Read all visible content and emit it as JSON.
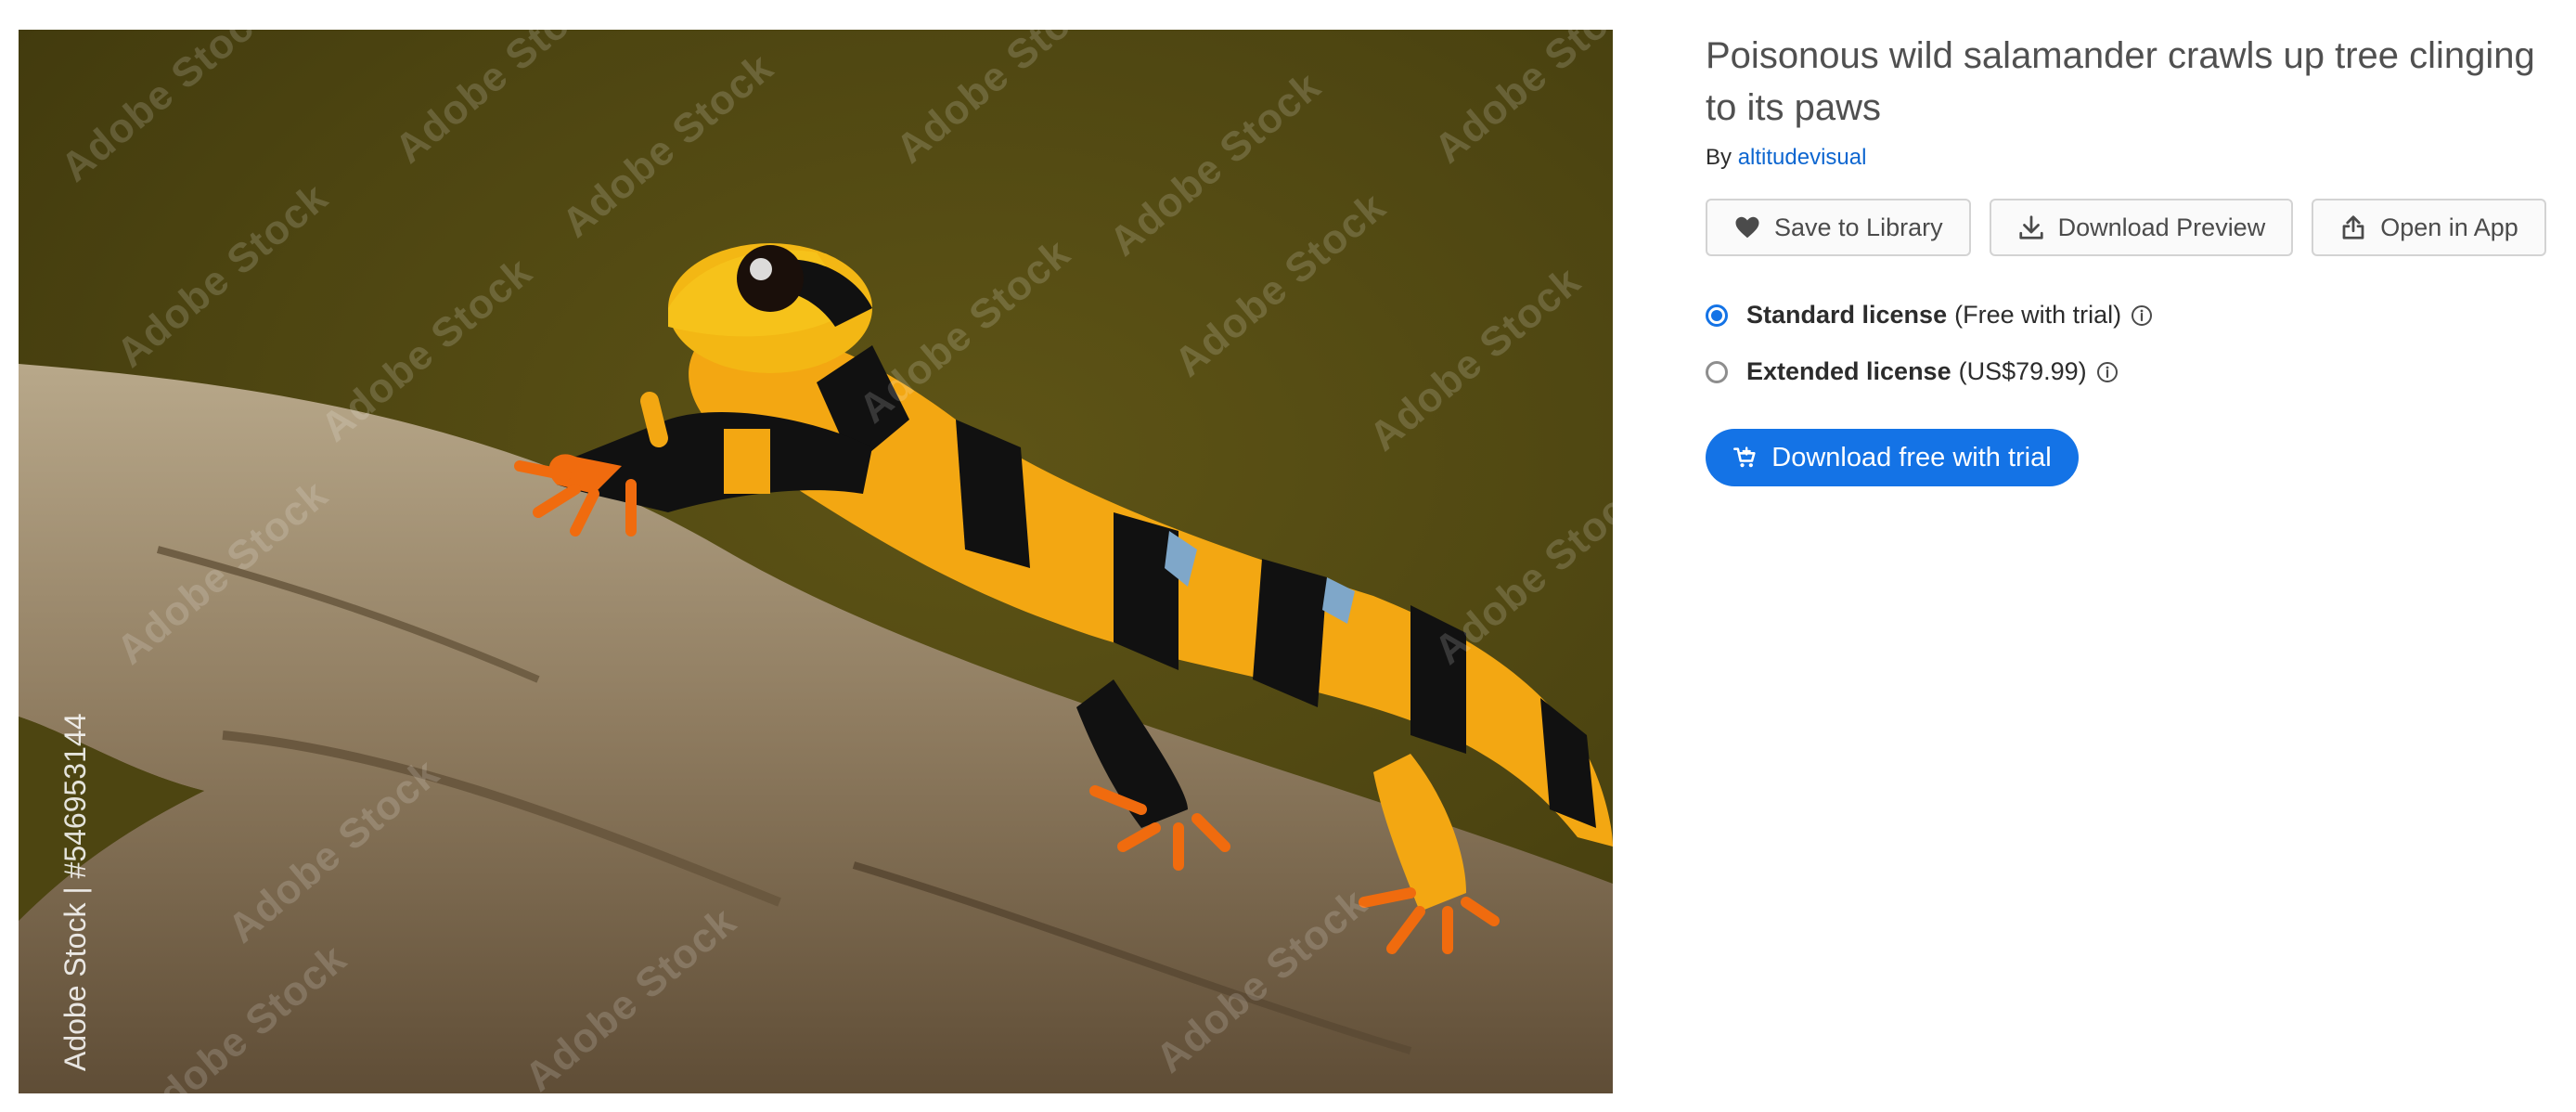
{
  "image": {
    "watermark_text": "Adobe Stock",
    "credit": "Adobe Stock | #546953144"
  },
  "asset": {
    "title": "Poisonous wild salamander crawls up tree clinging to its paws",
    "by_label": "By",
    "author": "altitudevisual"
  },
  "actions": {
    "save_label": "Save to Library",
    "download_preview_label": "Download Preview",
    "open_in_app_label": "Open in App"
  },
  "licenses": [
    {
      "name": "Standard license",
      "note": "(Free with trial)",
      "selected": true
    },
    {
      "name": "Extended license",
      "note": "(US$79.99)",
      "selected": false
    }
  ],
  "cta": {
    "label": "Download free with trial"
  },
  "colors": {
    "accent": "#1473e6",
    "link": "#0d66d0"
  },
  "icons": {
    "save": "heart-icon",
    "download": "download-icon",
    "open": "share-icon",
    "info": "info-icon",
    "cart": "cart-icon"
  }
}
